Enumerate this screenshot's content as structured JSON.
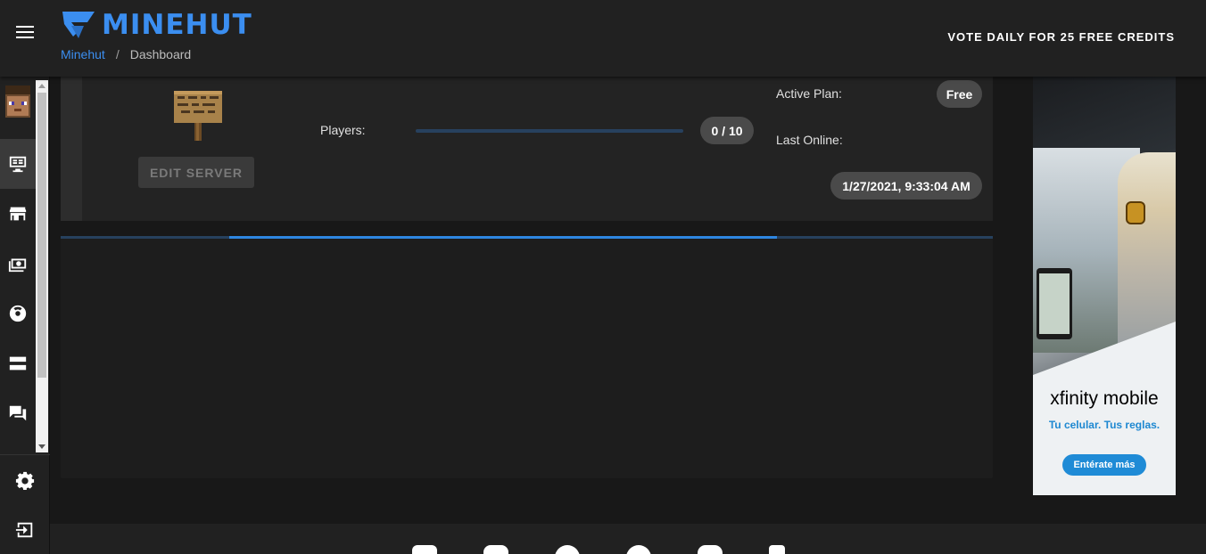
{
  "header": {
    "brand": "MINEHUT",
    "breadcrumb": {
      "root": "Minehut",
      "separator": "/",
      "current": "Dashboard"
    },
    "vote_label": "VOTE DAILY FOR 25 FREE CREDITS"
  },
  "sidebar": {
    "items": [
      {
        "name": "avatar",
        "icon": "player-head"
      },
      {
        "name": "servers",
        "icon": "monitor-icon",
        "active": true
      },
      {
        "name": "store",
        "icon": "store-icon"
      },
      {
        "name": "credits",
        "icon": "money-icon"
      },
      {
        "name": "support",
        "icon": "lifebuoy-icon"
      },
      {
        "name": "server-list",
        "icon": "dns-icon"
      },
      {
        "name": "forum",
        "icon": "chat-icon"
      }
    ],
    "bottom_items": [
      {
        "name": "settings",
        "icon": "gear-icon"
      },
      {
        "name": "logout",
        "icon": "logout-icon"
      }
    ]
  },
  "server": {
    "edit_label": "EDIT SERVER",
    "players_label": "Players:",
    "players_value": "0 / 10",
    "players_fraction": 0,
    "plan_label": "Active Plan:",
    "plan_value": "Free",
    "online_label": "Last Online:",
    "online_value": "1/27/2021, 9:33:04 AM"
  },
  "loading": {
    "progress_fraction": 0.4
  },
  "ad": {
    "brand": "xfinity mobile",
    "tagline": "Tu celular. Tus reglas.",
    "cta": "Entérate más"
  },
  "footer": {
    "social_icons": [
      "instagram-icon",
      "youtube-icon",
      "twitter-icon",
      "facebook-icon",
      "instagram-alt-icon",
      "tiktok-icon"
    ]
  },
  "colors": {
    "accent": "#3b8ef0",
    "background": "#181818",
    "surface": "#232323",
    "header": "#212121"
  }
}
